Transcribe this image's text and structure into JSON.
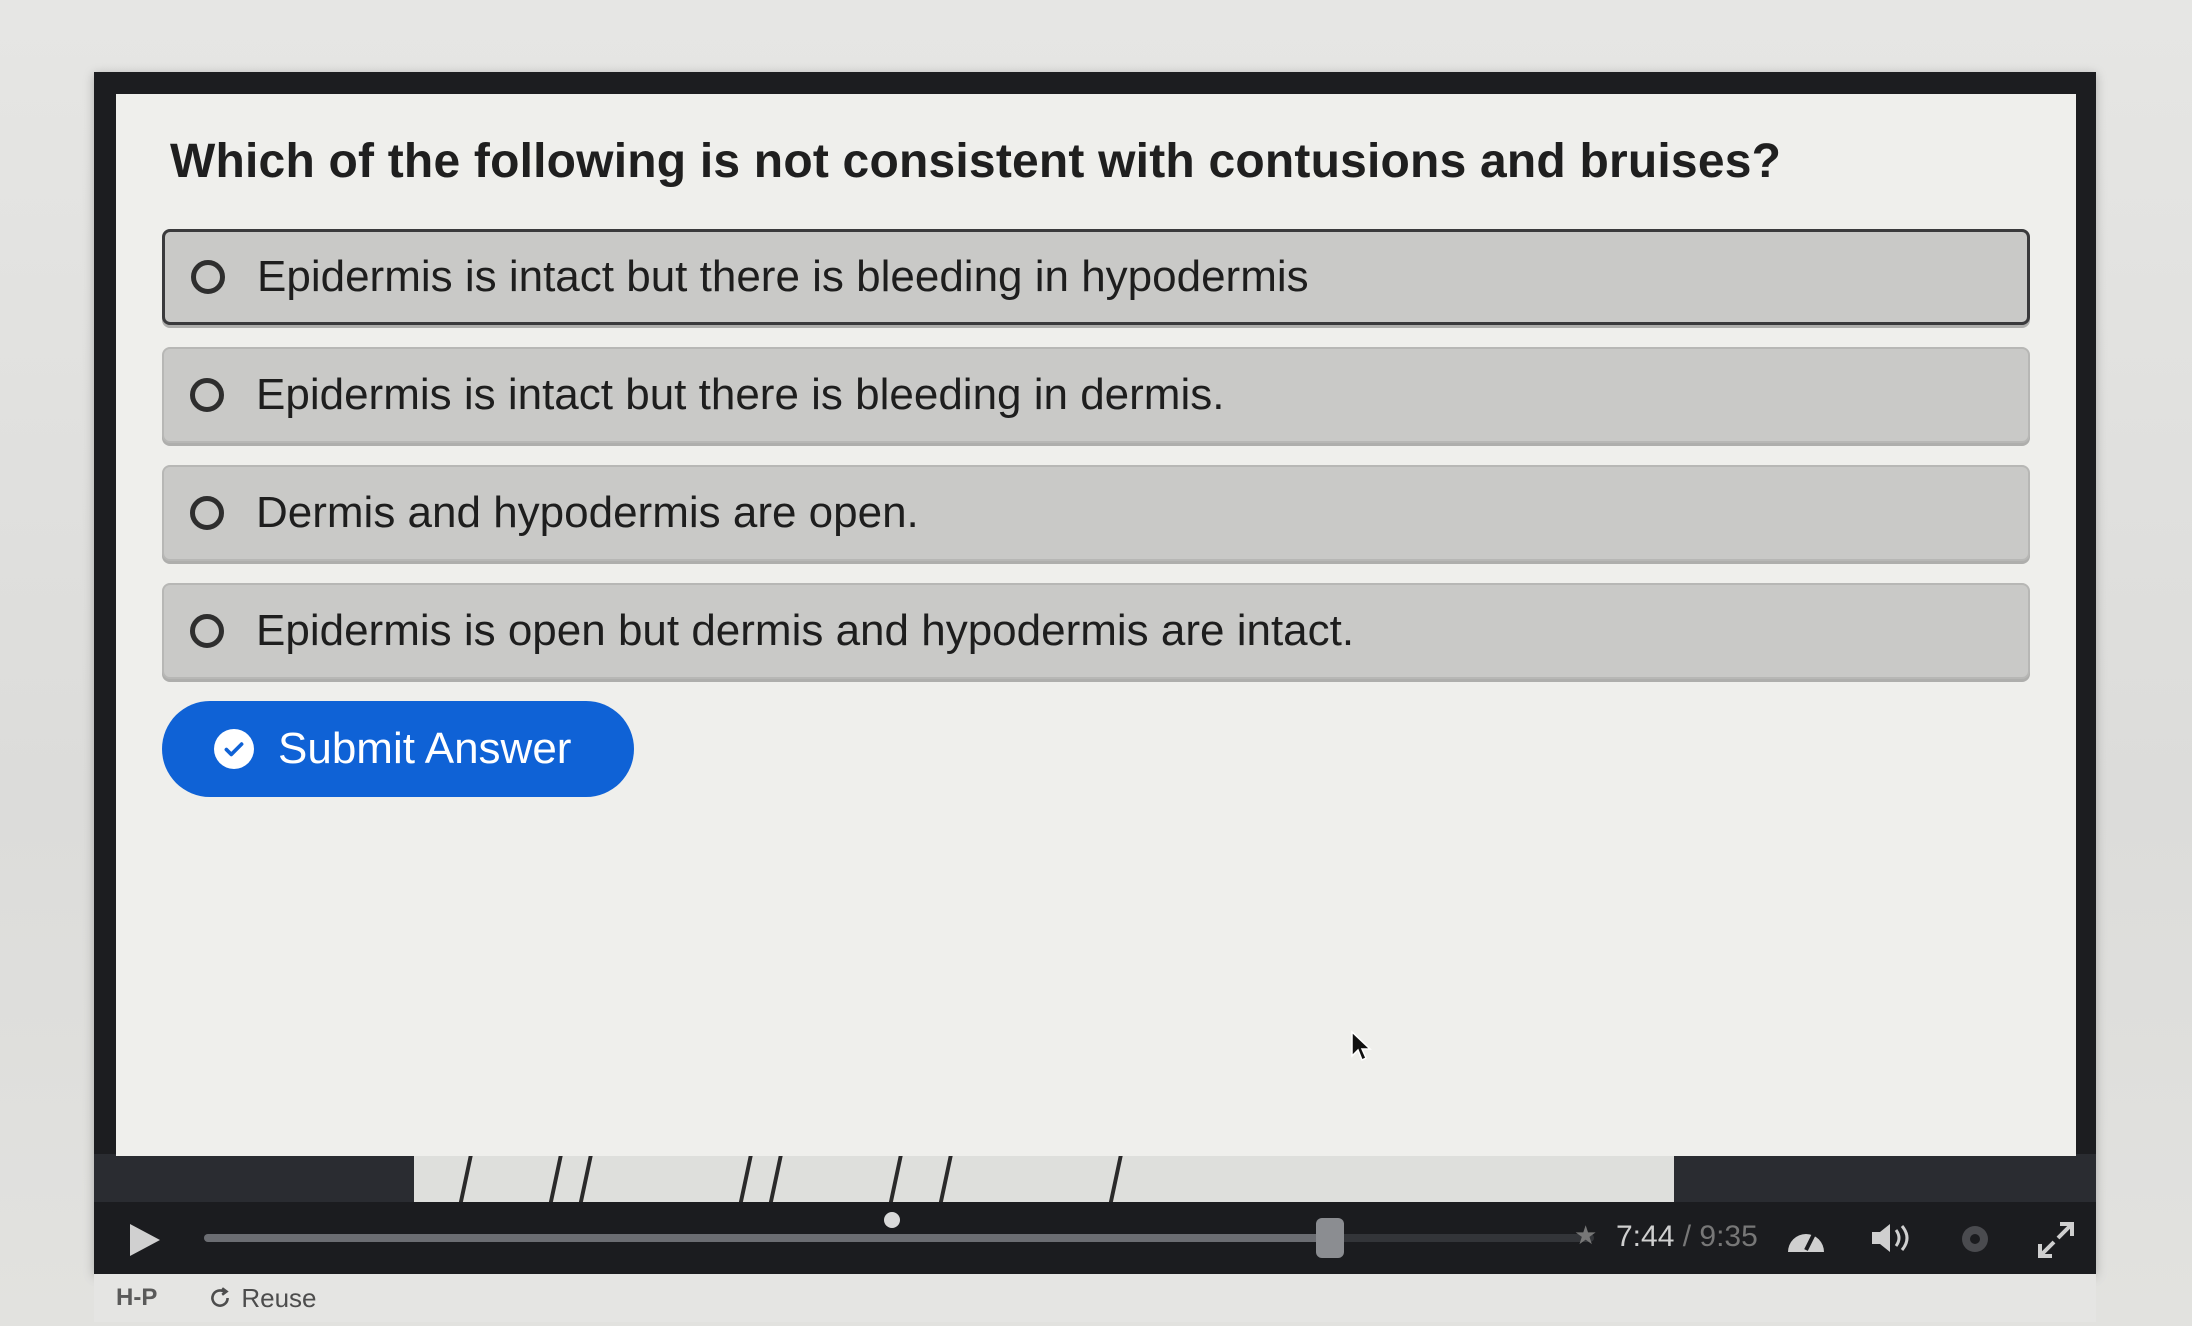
{
  "quiz": {
    "question": "Which of the following is not consistent with contusions and bruises?",
    "options": [
      {
        "label": "Epidermis is intact but there is bleeding in hypodermis"
      },
      {
        "label": "Epidermis is intact but there is bleeding in dermis."
      },
      {
        "label": "Dermis and hypodermis are open."
      },
      {
        "label": "Epidermis is open but dermis and hypodermis are intact."
      }
    ],
    "submit_label": "Submit Answer"
  },
  "player": {
    "current_time": "7:44",
    "separator": " / ",
    "total_time": "9:35",
    "progress_fraction": 0.81
  },
  "footer": {
    "logo": "H-P",
    "reuse_label": "Reuse"
  },
  "colors": {
    "accent": "#0f62d6",
    "option_bg": "#c9c9c7",
    "quiz_bg": "#efefec",
    "player_bg": "#1b1c1f"
  },
  "icons": [
    "radio-icon",
    "check-circle-icon",
    "play-icon",
    "speed-icon",
    "volume-icon",
    "gear-icon",
    "fullscreen-icon",
    "reuse-icon",
    "mouse-cursor-icon"
  ]
}
